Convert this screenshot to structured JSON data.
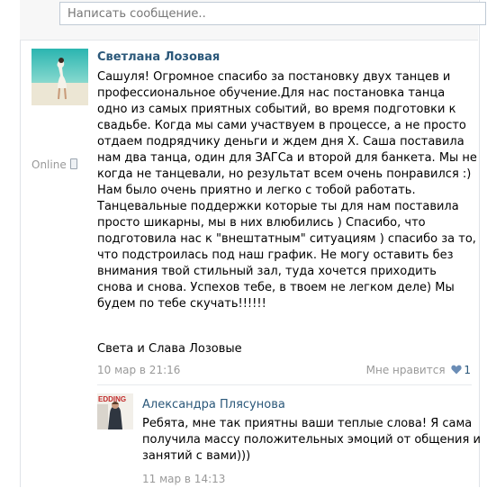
{
  "composer": {
    "placeholder": "Написать сообщение.."
  },
  "post": {
    "author": "Светлана Лозовая",
    "status": "Online",
    "text_lines": [
      "Сашуля! Огромное спасибо за постановку двух танцев и",
      "профессиональное обучение.Для нас постановка танца",
      "одно из самых приятных событий, во время подготовки к",
      "свадьбе. Когда мы сами участвуем в процессе, а не просто",
      "отдаем подрядчику деньги и ждем дня Х. Саша поставила",
      "нам два танца, один для ЗАГСа и второй для банкета. Мы не",
      "когда не танцевали, но результат всем очень понравился :)",
      "Нам было очень приятно и легко с тобой работать.",
      "Танцевальные поддержки которые ты для нам поставила",
      "просто шикарны, мы в них влюбились ) Спасибо, что",
      "подготовила нас к \"внештатным\" ситуациям ) спасибо за то,",
      "что подстроилась под наш график. Не могу оставить без",
      "внимания твой стильный зал, туда хочется приходить",
      "снова и снова. Успехов тебе, в твоем не легком деле) Мы",
      "будем по тебе скучать!!!!!!"
    ],
    "signature": "Света и Слава Лозовые",
    "date": "10 мар в 21:16",
    "like_label": "Мне нравится",
    "like_count": "1",
    "like_icon": "heart-icon",
    "like_color": "#6b8db6"
  },
  "reply": {
    "author": "Александра Плясунова",
    "text_lines": [
      "Ребята, мне так приятны ваши теплые слова! Я сама",
      "получила массу положительных эмоций от общения и",
      "занятий с вами)))"
    ],
    "date": "11 мар в 14:13",
    "avatar_text": "EDDING"
  },
  "colors": {
    "link": "#2b587a",
    "meta": "#999999",
    "input_border": "#c0cad5"
  }
}
